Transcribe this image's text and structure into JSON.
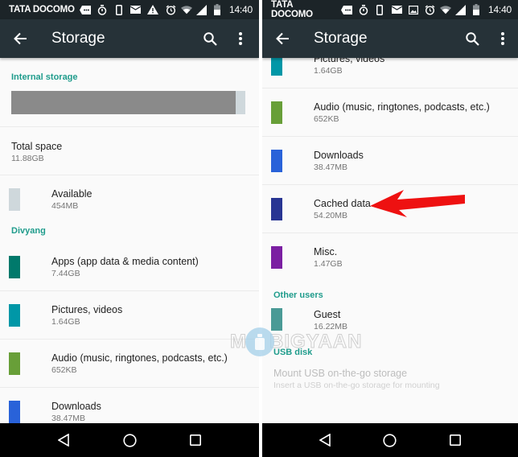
{
  "status_bar": {
    "carrier": "TATA DOCOMO",
    "time": "14:40",
    "left_icons_left_screen": [
      "message-icon",
      "stopwatch-icon",
      "phone-device-icon",
      "mail-icon",
      "warning-icon"
    ],
    "left_icons_right_screen": [
      "message-icon",
      "stopwatch-icon",
      "phone-device-icon",
      "mail-icon",
      "image-icon"
    ],
    "right_icons": [
      "alarm-icon",
      "wifi-icon",
      "signal-icon",
      "battery-icon"
    ]
  },
  "toolbar": {
    "title": "Storage",
    "back_icon": "arrow-back-icon",
    "search_icon": "search-icon",
    "overflow_icon": "more-vert-icon"
  },
  "left_screen": {
    "internal_header": "Internal storage",
    "storage_used_fraction": 0.96,
    "total": {
      "title": "Total space",
      "value": "11.88GB"
    },
    "available": {
      "title": "Available",
      "value": "454MB",
      "color": "#cfd8dc"
    },
    "user_header": "Divyang",
    "items": [
      {
        "title": "Apps (app data & media content)",
        "value": "7.44GB",
        "color": "#00796b"
      },
      {
        "title": "Pictures, videos",
        "value": "1.64GB",
        "color": "#0097a7"
      },
      {
        "title": "Audio (music, ringtones, podcasts, etc.)",
        "value": "652KB",
        "color": "#689f38"
      },
      {
        "title": "Downloads",
        "value": "38.47MB",
        "color": "#2962d9"
      }
    ]
  },
  "right_screen": {
    "items": [
      {
        "title": "Pictures, videos",
        "value": "1.64GB",
        "color": "#0097a7"
      },
      {
        "title": "Audio (music, ringtones, podcasts, etc.)",
        "value": "652KB",
        "color": "#689f38"
      },
      {
        "title": "Downloads",
        "value": "38.47MB",
        "color": "#2962d9"
      },
      {
        "title": "Cached data",
        "value": "54.20MB",
        "color": "#283593"
      },
      {
        "title": "Misc.",
        "value": "1.47GB",
        "color": "#7b1fa2"
      }
    ],
    "other_users_header": "Other users",
    "guest": {
      "title": "Guest",
      "value": "16.22MB",
      "color": "#4a9a96"
    },
    "usb_header": "USB disk",
    "usb": {
      "title": "Mount USB on-the-go storage",
      "subtitle": "Insert a USB on-the-go storage for mounting"
    }
  },
  "annotation": {
    "arrow_color": "#ee1111",
    "target": "Cached data"
  },
  "watermark": {
    "text": "BIGYAAN",
    "prefix": "M"
  },
  "nav_bar": {
    "back": "nav-back-icon",
    "home": "nav-home-icon",
    "recents": "nav-recents-icon"
  },
  "colors": {
    "accent": "#1f9c8c",
    "toolbar": "#263238",
    "status_bar": "#1c2428"
  }
}
